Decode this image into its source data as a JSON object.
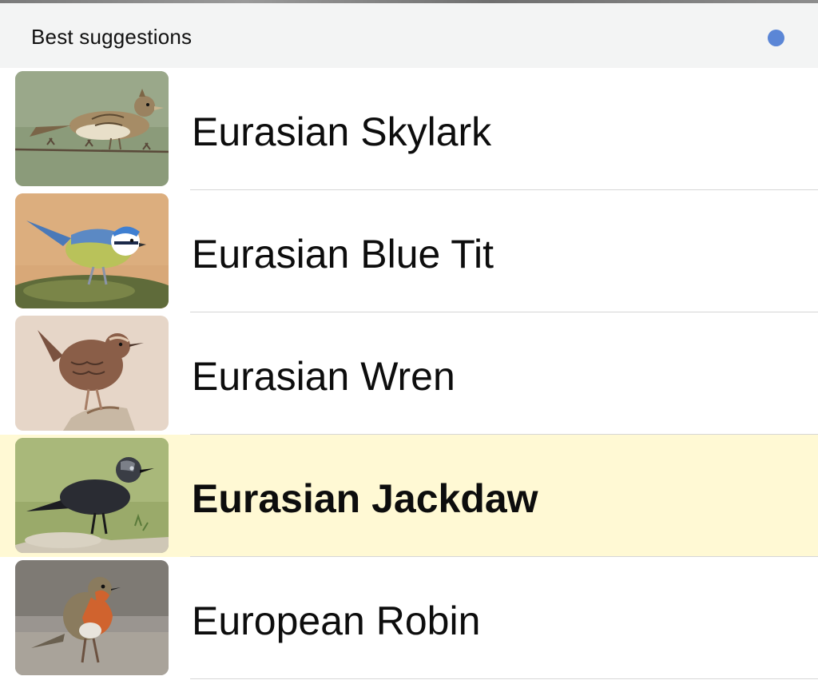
{
  "header": {
    "title": "Best suggestions",
    "status_dot_color": "#5b86d6"
  },
  "suggestions": [
    {
      "name": "Eurasian Skylark",
      "image_icon": "skylark-photo",
      "selected": false
    },
    {
      "name": "Eurasian Blue Tit",
      "image_icon": "blue-tit-photo",
      "selected": false
    },
    {
      "name": "Eurasian Wren",
      "image_icon": "wren-photo",
      "selected": false
    },
    {
      "name": "Eurasian Jackdaw",
      "image_icon": "jackdaw-photo",
      "selected": true
    },
    {
      "name": "European Robin",
      "image_icon": "robin-photo",
      "selected": false
    }
  ],
  "colors": {
    "highlight_background": "#fff9d4",
    "header_background": "#f3f4f4",
    "separator": "#d6d6d6"
  }
}
